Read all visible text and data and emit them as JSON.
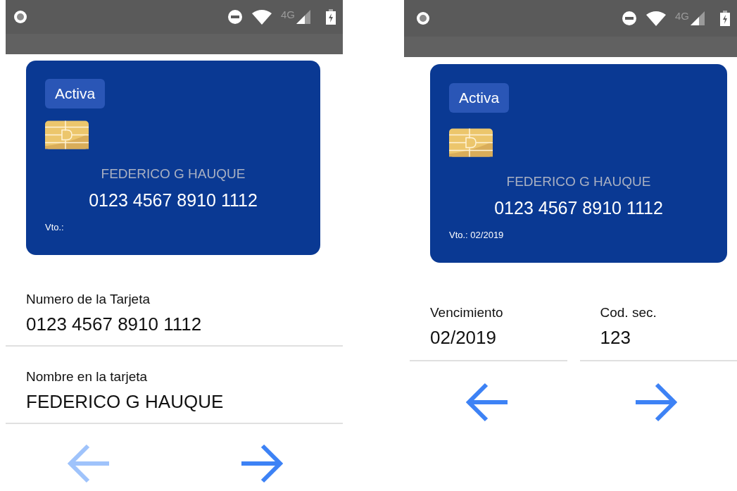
{
  "screens": [
    {
      "status_bar": {
        "network": "4G"
      },
      "card": {
        "badge": "Activa",
        "holder": "FEDERICO G HAUQUE",
        "number": "0123 4567 8910 1112",
        "expiry": "Vto.:"
      },
      "fields": [
        {
          "kind": "full",
          "label": "Numero de la Tarjeta",
          "value": "0123 4567 8910 1112"
        },
        {
          "kind": "full",
          "label": "Nombre en la tarjeta",
          "value": "FEDERICO G HAUQUE"
        }
      ],
      "nav": {
        "back_disabled": true,
        "forward_disabled": false
      }
    },
    {
      "status_bar": {
        "network": "4G"
      },
      "card": {
        "badge": "Activa",
        "holder": "FEDERICO G HAUQUE",
        "number": "0123 4567 8910 1112",
        "expiry": "Vto.: 02/2019"
      },
      "fields": [
        {
          "kind": "half",
          "label": "Vencimiento",
          "value": "02/2019"
        },
        {
          "kind": "half",
          "label": "Cod. sec.",
          "value": "123"
        }
      ],
      "nav": {
        "back_disabled": false,
        "forward_disabled": false
      }
    }
  ]
}
